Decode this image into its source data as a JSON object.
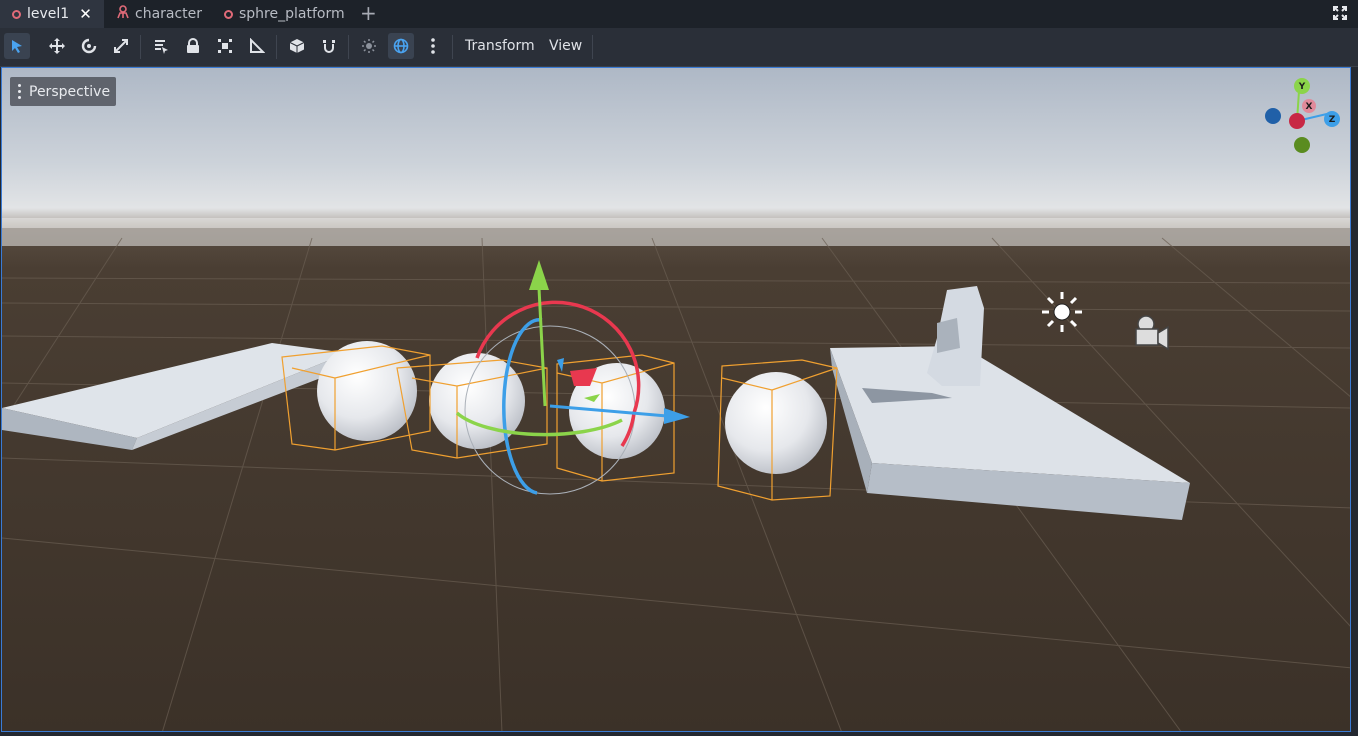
{
  "tabs": [
    {
      "label": "level1",
      "active": true
    },
    {
      "label": "character",
      "active": false
    },
    {
      "label": "sphre_platform",
      "active": false
    }
  ],
  "toolbar": {
    "menus": [
      "Transform",
      "View"
    ],
    "tools": [
      "select-icon",
      "move-icon",
      "rotate-icon",
      "scale-icon",
      "list-select-icon",
      "lock-icon",
      "group-icon",
      "ruler-icon",
      "local-space-icon",
      "snap-icon",
      "sun-toggle-icon",
      "environment-toggle-icon",
      "more-icon"
    ]
  },
  "viewport": {
    "perspective_label": "Perspective",
    "axes": {
      "x": "X",
      "y": "Y",
      "z": "Z"
    }
  },
  "colors": {
    "accent": "#3a7bd5",
    "x_axis": "#e8384f",
    "y_axis": "#8bd44a",
    "z_axis": "#3d9fe8",
    "selection": "#f0a030"
  }
}
